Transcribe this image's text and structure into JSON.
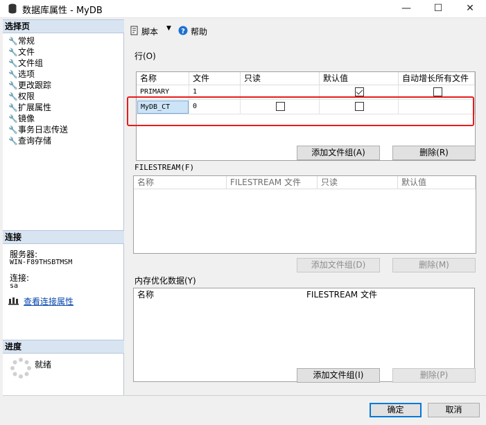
{
  "window": {
    "title": "数据库属性 - MyDB",
    "minimize": "—",
    "maximize": "☐",
    "close": "✕"
  },
  "left": {
    "select_page_header": "选择页",
    "pages": [
      "常规",
      "文件",
      "文件组",
      "选项",
      "更改跟踪",
      "权限",
      "扩展属性",
      "镜像",
      "事务日志传送",
      "查询存储"
    ],
    "connection_header": "连接",
    "server_label": "服务器:",
    "server_value": "WIN-F89THSBTMSM",
    "conn_label": "连接:",
    "conn_value": "sa",
    "view_conn_link": "查看连接属性",
    "progress_header": "进度",
    "progress_status": "就绪"
  },
  "toolbar": {
    "script_label": "脚本",
    "help_label": "帮助"
  },
  "rows_section": {
    "label": "行(O)",
    "columns": [
      "名称",
      "文件",
      "只读",
      "默认值",
      "自动增长所有文件"
    ],
    "rows": [
      {
        "name": "PRIMARY",
        "files": "1",
        "readonly": false,
        "default": true,
        "autogrow": false
      },
      {
        "name": "MyDB_CT",
        "files": "0",
        "readonly": false,
        "default": false,
        "autogrow": null
      }
    ],
    "add_button": "添加文件组(A)",
    "delete_button": "删除(R)"
  },
  "filestream_section": {
    "label": "FILESTREAM(F)",
    "columns": [
      "名称",
      "FILESTREAM 文件",
      "只读",
      "默认值"
    ],
    "add_button": "添加文件组(D)",
    "delete_button": "删除(M)"
  },
  "memory_section": {
    "label": "内存优化数据(Y)",
    "columns": [
      "名称",
      "FILESTREAM 文件"
    ],
    "add_button": "添加文件组(I)",
    "delete_button": "删除(P)"
  },
  "footer": {
    "ok_button": "确定",
    "cancel_button": "取消"
  },
  "colors": {
    "highlight_box": "#e81b1b",
    "selected_cell": "#cce4f7",
    "header_band": "#d9e4f2"
  }
}
